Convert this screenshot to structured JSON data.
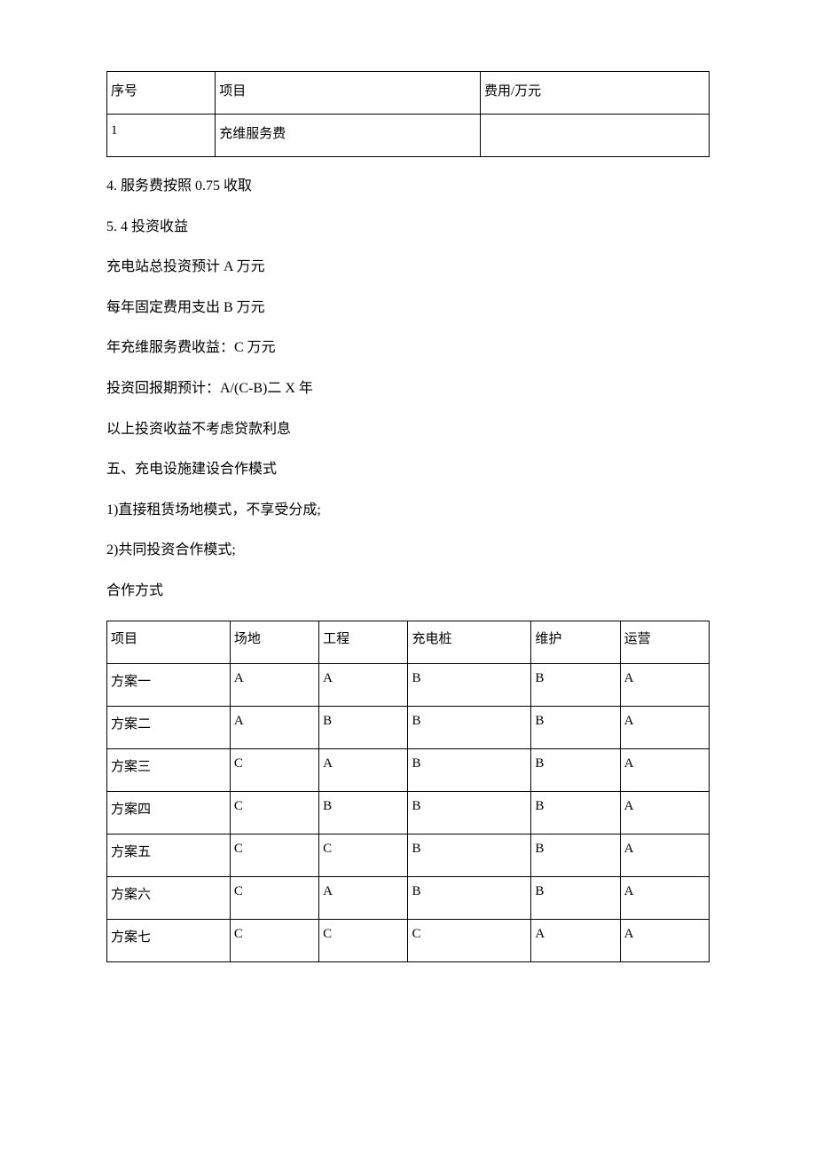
{
  "table1": {
    "headers": [
      "序号",
      "项目",
      "费用/万元"
    ],
    "rows": [
      {
        "c1": "1",
        "c2": "充维服务费",
        "c3": ""
      }
    ]
  },
  "paragraphs": {
    "p4": "4. 服务费按照 0.75 收取",
    "p5": "5. 4 投资收益",
    "p6": "充电站总投资预计 A 万元",
    "p7": "每年固定费用支出 B 万元",
    "p8": "年充维服务费收益：C 万元",
    "p9": "投资回报期预计：A/(C-B)二 X 年",
    "p10": "以上投资收益不考虑贷款利息",
    "p11": "五、充电设施建设合作模式",
    "p12": "1)直接租赁场地模式，不享受分成;",
    "p13": "2)共同投资合作模式;",
    "p14": "合作方式"
  },
  "table2": {
    "headers": [
      "项目",
      "场地",
      "工程",
      "充电桩",
      "维护",
      "运营"
    ],
    "rows": [
      {
        "c1": "方案一",
        "c2": "A",
        "c3": "A",
        "c4": "B",
        "c5": "B",
        "c6": "A"
      },
      {
        "c1": "方案二",
        "c2": "A",
        "c3": "B",
        "c4": "B",
        "c5": "B",
        "c6": "A"
      },
      {
        "c1": "方案三",
        "c2": "C",
        "c3": "A",
        "c4": "B",
        "c5": "B",
        "c6": "A"
      },
      {
        "c1": "方案四",
        "c2": "C",
        "c3": "B",
        "c4": "B",
        "c5": "B",
        "c6": "A"
      },
      {
        "c1": "方案五",
        "c2": "C",
        "c3": "C",
        "c4": "B",
        "c5": "B",
        "c6": "A"
      },
      {
        "c1": "方案六",
        "c2": "C",
        "c3": "A",
        "c4": "B",
        "c5": "B",
        "c6": "A"
      },
      {
        "c1": "方案七",
        "c2": "C",
        "c3": "C",
        "c4": "C",
        "c5": "A",
        "c6": "A"
      }
    ]
  }
}
